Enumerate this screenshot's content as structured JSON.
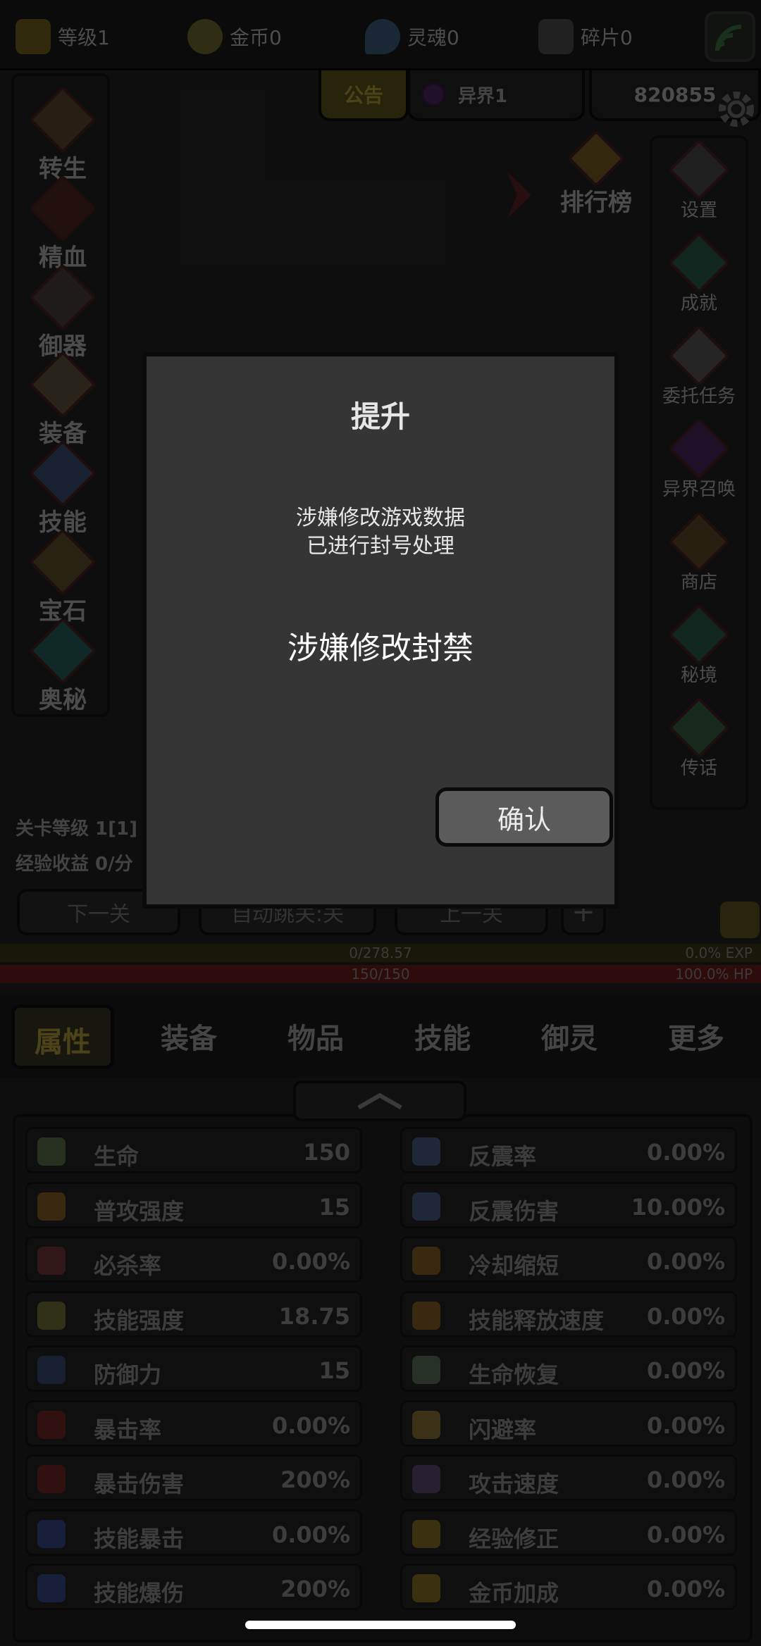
{
  "topbar": {
    "resources": [
      {
        "label": "等级1",
        "icon": "crown-icon",
        "color": "#7a6a1e"
      },
      {
        "label": "金币0",
        "icon": "coin-icon",
        "color": "#6c6a2a"
      },
      {
        "label": "灵魂0",
        "icon": "soul-icon",
        "color": "#3f5d78"
      },
      {
        "label": "碎片0",
        "icon": "shard-icon",
        "color": "#4a4a4a"
      }
    ]
  },
  "subbar": {
    "notice_label": "公告",
    "realm_label": "异界1",
    "id_value": "820855"
  },
  "left_menu": [
    "转生",
    "精血",
    "御器",
    "装备",
    "技能",
    "宝石",
    "奥秘"
  ],
  "ranking_label": "排行榜",
  "right_menu": [
    "设置",
    "成就",
    "委托任务",
    "异界召唤",
    "商店",
    "秘境",
    "传话"
  ],
  "stage": {
    "level_text": "关卡等级 1[1]",
    "exp_text": "经验收益 0/分"
  },
  "nav_buttons": {
    "next": "下一关",
    "auto": "自动跳关:关",
    "prev": "上一关"
  },
  "exp_bar": {
    "text": "0/278.57",
    "percent": "0.0% EXP",
    "fill": 0.0
  },
  "hp_bar": {
    "text": "150/150",
    "percent": "100.0%  HP",
    "fill": 1.0
  },
  "tabs": [
    "属性",
    "装备",
    "物品",
    "技能",
    "御灵",
    "更多"
  ],
  "active_tab": "属性",
  "stats_left": [
    {
      "name": "生命",
      "value": "150",
      "icon": "health-cross-icon",
      "color": "#4a5a3a"
    },
    {
      "name": "普攻强度",
      "value": "15",
      "icon": "sword-icon",
      "color": "#6a4a1e"
    },
    {
      "name": "必杀率",
      "value": "0.00%",
      "icon": "slash-icon",
      "color": "#5a2a2a"
    },
    {
      "name": "技能强度",
      "value": "18.75",
      "icon": "lightning-icon",
      "color": "#5a5a2a"
    },
    {
      "name": "防御力",
      "value": "15",
      "icon": "shield-icon",
      "color": "#2a3a5a"
    },
    {
      "name": "暴击率",
      "value": "0.00%",
      "icon": "claw-icon",
      "color": "#5a1e1e"
    },
    {
      "name": "暴击伤害",
      "value": "200%",
      "icon": "claw-icon",
      "color": "#5a1e1e"
    },
    {
      "name": "技能暴击",
      "value": "0.00%",
      "icon": "flame-icon",
      "color": "#2a3a6a"
    },
    {
      "name": "技能爆伤",
      "value": "200%",
      "icon": "flame-icon",
      "color": "#2a3a6a"
    }
  ],
  "stats_right": [
    {
      "name": "反震率",
      "value": "0.00%",
      "icon": "burst-icon",
      "color": "#3a4a6a"
    },
    {
      "name": "反震伤害",
      "value": "10.00%",
      "icon": "burst-icon",
      "color": "#3a4a6a"
    },
    {
      "name": "冷却缩短",
      "value": "0.00%",
      "icon": "cooldown-icon",
      "color": "#6a4a1e"
    },
    {
      "name": "技能释放速度",
      "value": "0.00%",
      "icon": "cast-speed-icon",
      "color": "#6a4a1e"
    },
    {
      "name": "生命恢复",
      "value": "0.00%",
      "icon": "regen-icon",
      "color": "#4a5a4a"
    },
    {
      "name": "闪避率",
      "value": "0.00%",
      "icon": "boot-icon",
      "color": "#6a5a2a"
    },
    {
      "name": "攻击速度",
      "value": "0.00%",
      "icon": "crossed-swords-icon",
      "color": "#4a3a5a"
    },
    {
      "name": "经验修正",
      "value": "0.00%",
      "icon": "crown-icon",
      "color": "#6a5a1e"
    },
    {
      "name": "金币加成",
      "value": "0.00%",
      "icon": "coin-icon",
      "color": "#6a5a1e"
    }
  ],
  "dialog": {
    "title": "提升",
    "message_line1": "涉嫌修改游戏数据",
    "message_line2": "已进行封号处理",
    "ban_text": "涉嫌修改封禁",
    "confirm_label": "确认"
  }
}
